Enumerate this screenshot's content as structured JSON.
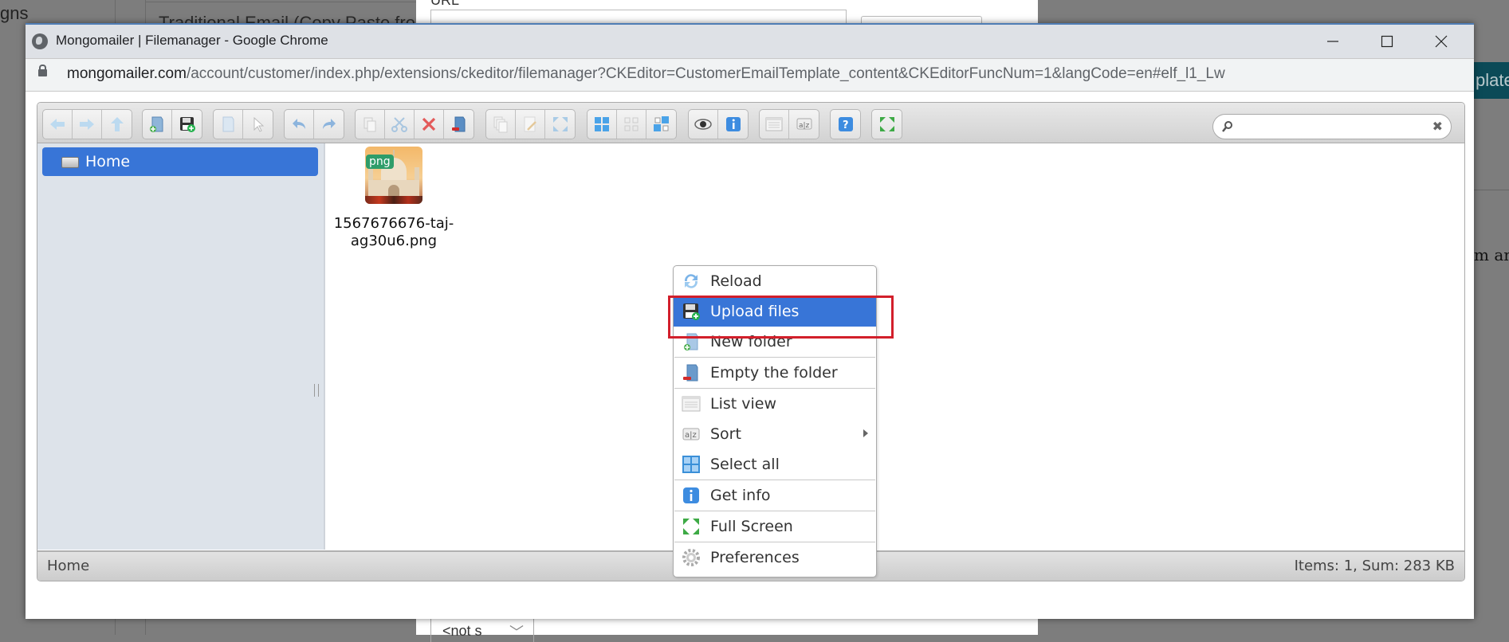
{
  "background": {
    "left_text": "gns",
    "box_text": "Traditional Email (Copy Paste fron",
    "dialog_url_label": "URL",
    "select_value": "<not s",
    "right_dark_text": "plate",
    "right_text": "m an"
  },
  "window": {
    "title": "Mongomailer | Filemanager - Google Chrome",
    "minimize_label": "—",
    "maximize_label": "☐",
    "close_label": "✕"
  },
  "address": {
    "host": "mongomailer.com",
    "path": "/account/customer/index.php/extensions/ckeditor/filemanager?CKEditor=CustomerEmailTemplate_content&CKEditorFuncNum=1&langCode=en#elf_l1_Lw"
  },
  "toolbar": {
    "groups": [
      [
        "back",
        "forward",
        "up"
      ],
      [
        "new-folder",
        "upload"
      ],
      [
        "open",
        "select"
      ],
      [
        "undo",
        "redo"
      ],
      [
        "copy",
        "cut",
        "delete",
        "empty-folder"
      ],
      [
        "duplicate",
        "rename",
        "resize"
      ],
      [
        "select-all",
        "select-none",
        "select-invert"
      ],
      [
        "preview",
        "info"
      ],
      [
        "list-view",
        "sort"
      ],
      [
        "help"
      ],
      [
        "fullscreen"
      ]
    ],
    "search": {
      "placeholder": "",
      "value": ""
    }
  },
  "navbar": {
    "items": [
      {
        "label": "Home",
        "selected": true
      }
    ]
  },
  "files": [
    {
      "name": "1567676676-taj-ag30u6.png",
      "badge": "png"
    }
  ],
  "statusbar": {
    "path": "Home",
    "summary": "Items: 1, Sum: 283 KB"
  },
  "context_menu": {
    "items": [
      {
        "label": "Reload",
        "icon": "reload-icon"
      },
      {
        "label": "Upload files",
        "icon": "upload-icon",
        "highlighted": true
      },
      {
        "label": "New folder",
        "icon": "new-folder-icon"
      },
      {
        "label": "Empty the folder",
        "icon": "empty-folder-icon"
      },
      {
        "label": "List view",
        "icon": "list-view-icon"
      },
      {
        "label": "Sort",
        "icon": "sort-icon",
        "submenu": true
      },
      {
        "label": "Select all",
        "icon": "select-all-icon"
      },
      {
        "label": "Get info",
        "icon": "info-icon"
      },
      {
        "label": "Full Screen",
        "icon": "fullscreen-icon"
      },
      {
        "label": "Preferences",
        "icon": "preferences-icon"
      }
    ]
  },
  "colors": {
    "selection": "#3875d7",
    "highlight_box": "#d21f2b",
    "badge": "#2f9d6a"
  }
}
